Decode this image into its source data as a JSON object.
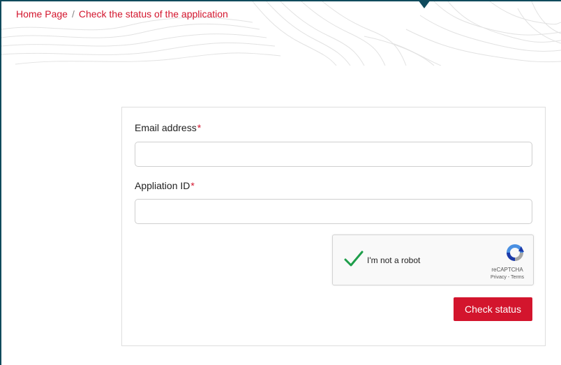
{
  "breadcrumb": {
    "home": "Home Page",
    "separator": "/",
    "current": "Check the status of the application"
  },
  "form": {
    "email_label": "Email address",
    "email_required": "*",
    "email_value": "",
    "app_id_label": "Appliation ID",
    "app_id_required": "*",
    "app_id_value": "",
    "submit_label": "Check status"
  },
  "recaptcha": {
    "checkbox_label": "I'm not a robot",
    "brand": "reCAPTCHA",
    "terms": "Privacy - Terms",
    "logo_icon": "recaptcha-logo-icon",
    "check_icon": "checkmark-icon"
  },
  "colors": {
    "accent": "#d3152d",
    "frame": "#0f4a5c",
    "check": "#1e9e4a"
  }
}
